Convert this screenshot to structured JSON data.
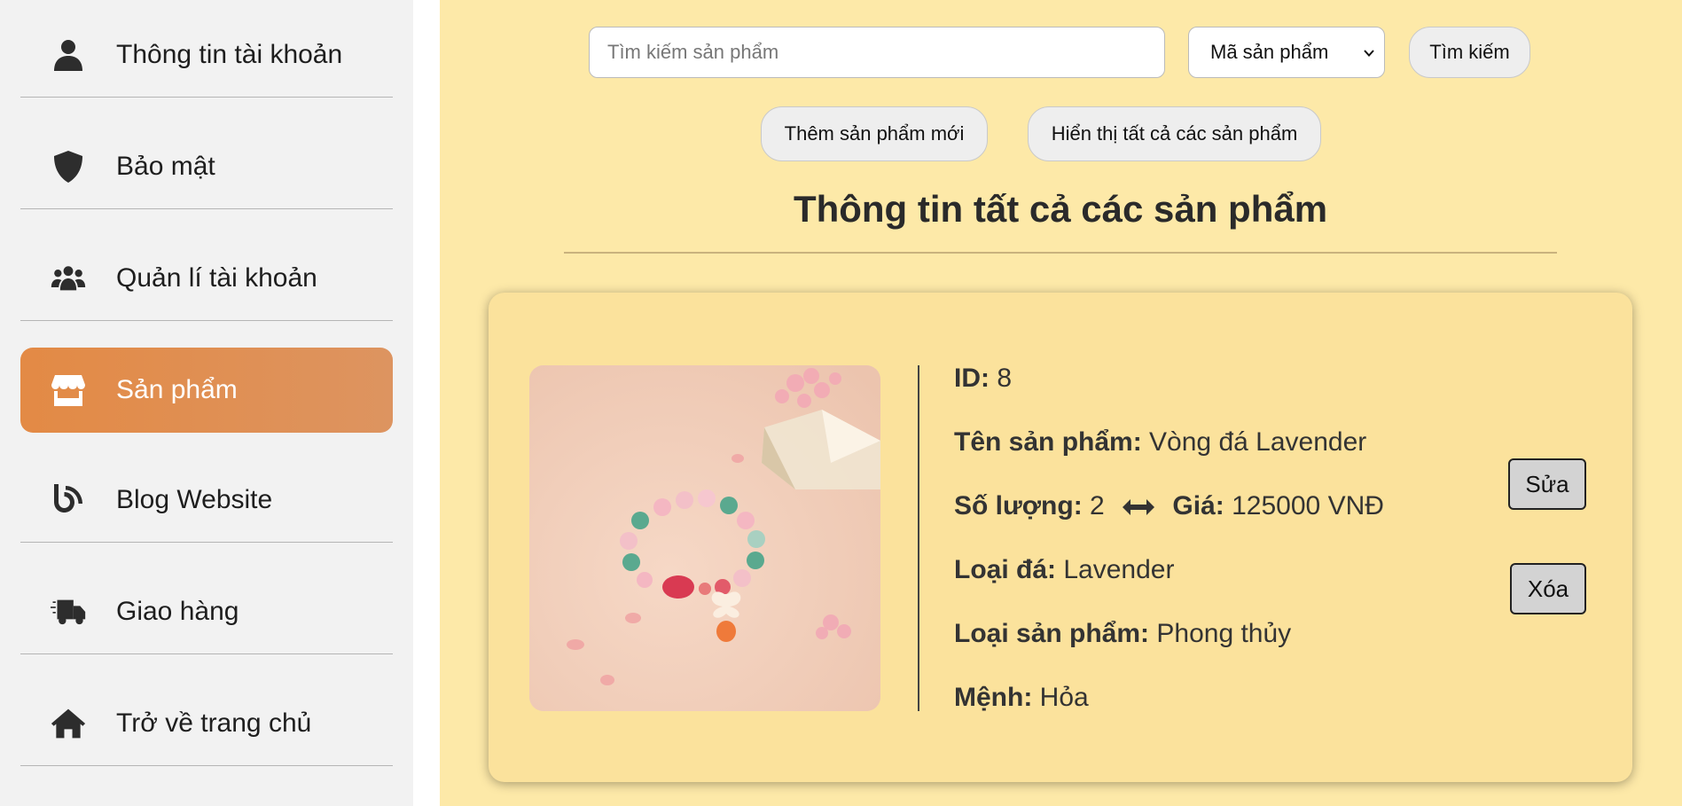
{
  "sidebar": {
    "items": [
      {
        "label": "Thông tin tài khoản",
        "icon": "user-icon",
        "active": false
      },
      {
        "label": "Bảo mật",
        "icon": "shield-icon",
        "active": false
      },
      {
        "label": "Quản lí tài khoản",
        "icon": "users-icon",
        "active": false
      },
      {
        "label": "Sản phẩm",
        "icon": "store-icon",
        "active": true
      },
      {
        "label": "Blog Website",
        "icon": "blog-icon",
        "active": false
      },
      {
        "label": "Giao hàng",
        "icon": "truck-icon",
        "active": false
      },
      {
        "label": "Trở về trang chủ",
        "icon": "home-icon",
        "active": false
      }
    ]
  },
  "toolbar": {
    "search_placeholder": "Tìm kiếm sản phẩm",
    "search_value": "",
    "select_value": "Mã sản phẩm",
    "search_button": "Tìm kiếm",
    "add_button": "Thêm sản phẩm mới",
    "show_all_button": "Hiển thị tất cả các sản phẩm"
  },
  "page": {
    "title": "Thông tin tất cả các sản phẩm"
  },
  "product": {
    "id_label": "ID:",
    "id": "8",
    "name_label": "Tên sản phẩm:",
    "name": "Vòng đá Lavender",
    "qty_label": "Số lượng:",
    "qty": "2",
    "price_label": "Giá:",
    "price": "125000 VNĐ",
    "stone_label": "Loại đá:",
    "stone": "Lavender",
    "type_label": "Loại sản phẩm:",
    "type": "Phong thủy",
    "element_label": "Mệnh:",
    "element": "Hỏa",
    "edit_button": "Sửa",
    "delete_button": "Xóa"
  },
  "colors": {
    "sidebar_bg": "#f2f2f2",
    "active_accent": "#e38a45",
    "main_bg": "#fde9a8",
    "card_bg": "#fbe29c"
  }
}
